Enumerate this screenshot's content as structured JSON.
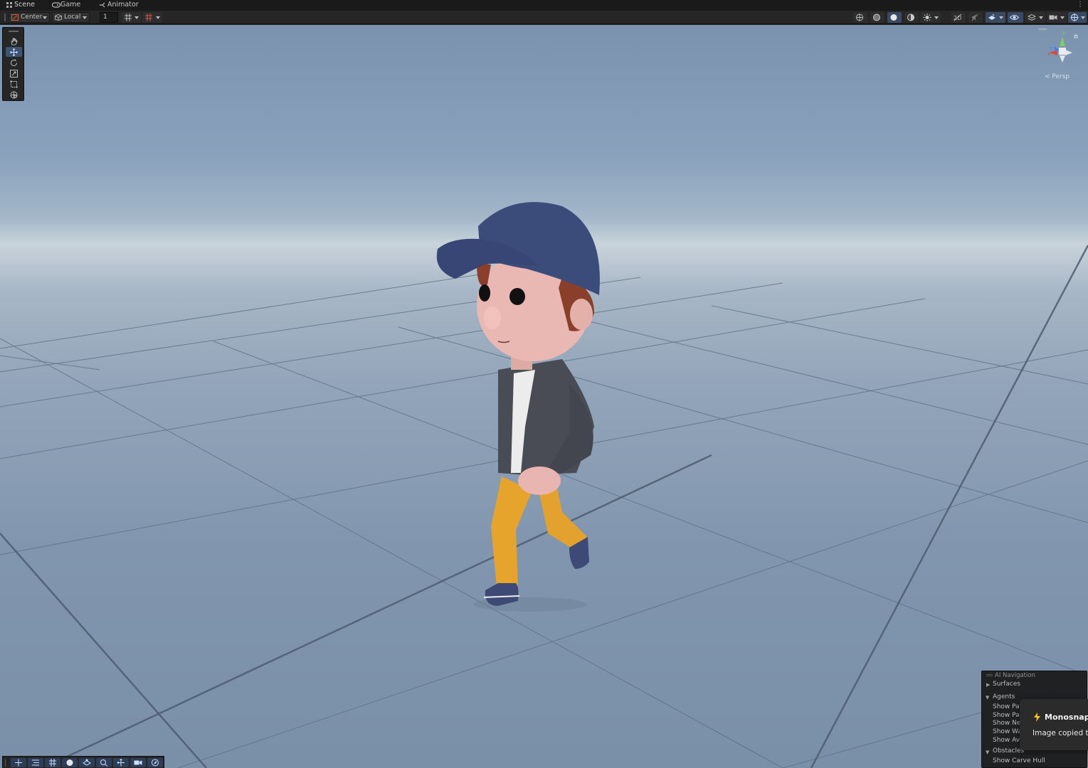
{
  "tabs": [
    {
      "label": "Scene",
      "icon": "grid-icon",
      "active": true
    },
    {
      "label": "Game",
      "icon": "gamepad-icon",
      "active": false
    },
    {
      "label": "Animator",
      "icon": "animator-icon",
      "active": false
    }
  ],
  "toolbar": {
    "pivot_mode": "Center",
    "pivot_rotation": "Local",
    "grid_snap_value": "1"
  },
  "tools": [
    "hand-tool",
    "move-tool",
    "rotate-tool",
    "scale-tool",
    "rect-tool",
    "transform-tool"
  ],
  "gizmo": {
    "axis_y": "y",
    "axis_x": "x",
    "axis_z": "z",
    "projection_label": "< Persp"
  },
  "ai_navigation": {
    "title": "AI Navigation",
    "surfaces": "Surfaces",
    "agents": "Agents",
    "agent_items": [
      "Show Pat",
      "Show Pat",
      "Show Ne",
      "Show Wa",
      "Show Avo"
    ],
    "obstacles": "Obstacles",
    "obstacle_items": [
      "Show Carve Hull"
    ]
  },
  "toast": {
    "app": "Monosnap",
    "message": "Image copied to"
  },
  "colors": {
    "accent": "#3d5372",
    "viewport_sky": "#7a92ae",
    "horizon": "#c8d4da"
  }
}
